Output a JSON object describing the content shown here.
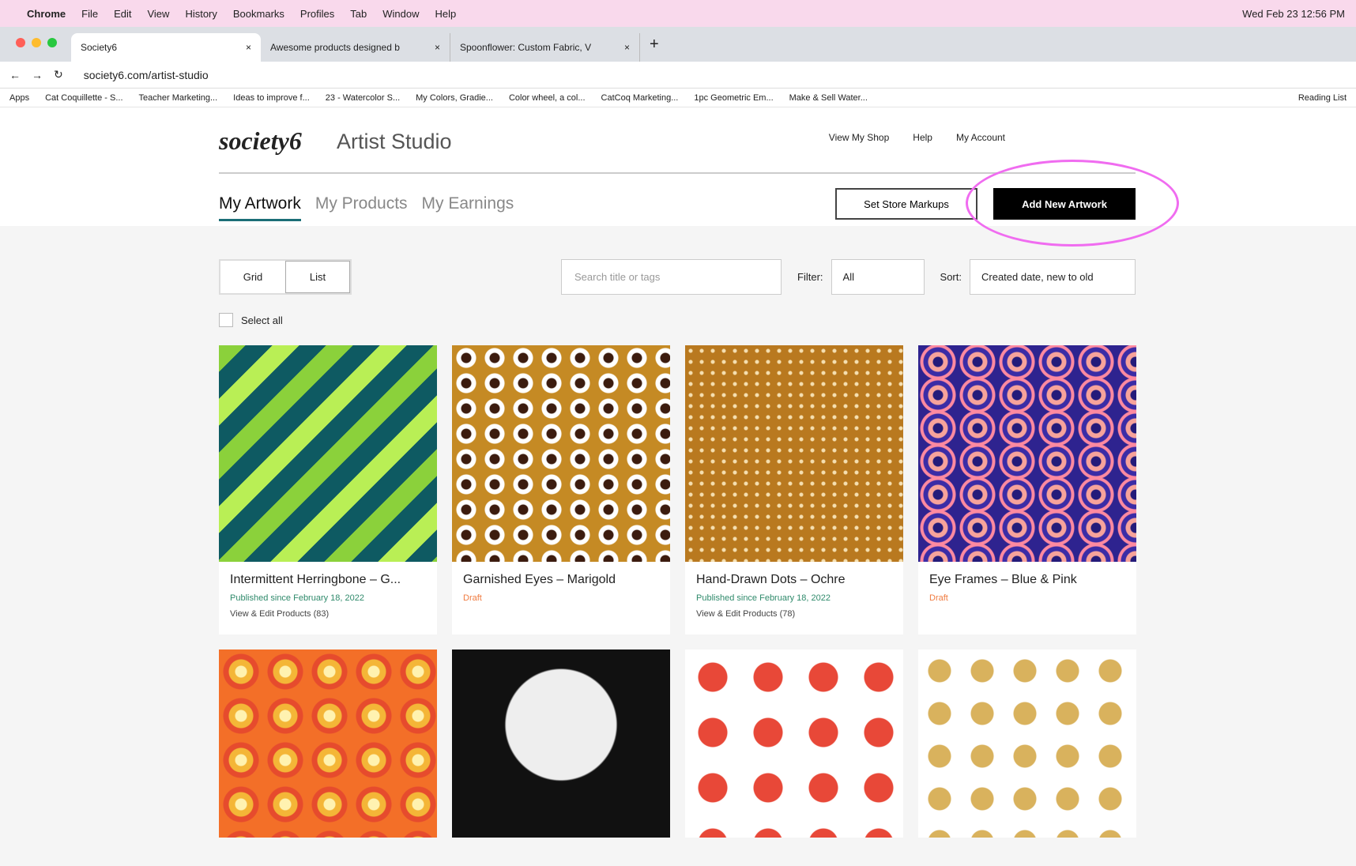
{
  "menubar": {
    "app": "Chrome",
    "items": [
      "File",
      "Edit",
      "View",
      "History",
      "Bookmarks",
      "Profiles",
      "Tab",
      "Window",
      "Help"
    ],
    "datetime": "Wed Feb 23 12:56 PM"
  },
  "tabs": [
    {
      "label": "Society6"
    },
    {
      "label": "Awesome products designed b"
    },
    {
      "label": "Spoonflower: Custom Fabric, V"
    }
  ],
  "address": "society6.com/artist-studio",
  "bookmarks": [
    "Apps",
    "Cat Coquillette - S...",
    "Teacher Marketing...",
    "Ideas to improve f...",
    "23 - Watercolor S...",
    "My Colors, Gradie...",
    "Color wheel, a col...",
    "CatCoq Marketing...",
    "1pc Geometric Em...",
    "Make & Sell Water...",
    "Reading List"
  ],
  "header": {
    "logo": "society6",
    "title": "Artist Studio",
    "nav": [
      "View My Shop",
      "Help",
      "My Account"
    ]
  },
  "tabs2": [
    "My Artwork",
    "My Products",
    "My Earnings"
  ],
  "buttons": {
    "markups": "Set Store Markups",
    "add": "Add New Artwork"
  },
  "toolbar": {
    "grid": "Grid",
    "list": "List",
    "search_placeholder": "Search title or tags",
    "filter_label": "Filter:",
    "filter_value": "All",
    "sort_label": "Sort:",
    "sort_value": "Created date, new to old",
    "select_all": "Select all"
  },
  "artworks": [
    {
      "title": "Intermittent Herringbone – G...",
      "status": "Published since February 18, 2022",
      "link": "View & Edit Products (83)"
    },
    {
      "title": "Garnished Eyes – Marigold",
      "status": "Draft",
      "link": ""
    },
    {
      "title": "Hand-Drawn Dots – Ochre",
      "status": "Published since February 18, 2022",
      "link": "View & Edit Products (78)"
    },
    {
      "title": "Eye Frames – Blue & Pink",
      "status": "Draft",
      "link": ""
    }
  ]
}
